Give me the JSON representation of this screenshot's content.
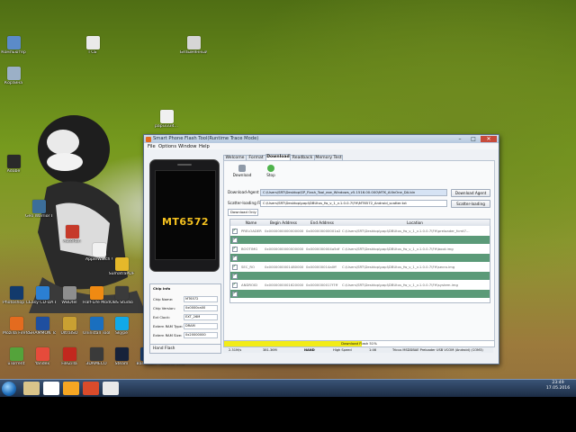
{
  "window": {
    "title": "Smart Phone Flash Tool(Runtime Trace Mode)",
    "controls": [
      "–",
      "□",
      "✕"
    ],
    "menus": [
      "File",
      "Options",
      "Window",
      "Help"
    ],
    "phone_chip": "MT6572",
    "tabs": [
      "Welcome",
      "Format",
      "Download",
      "Readback",
      "Memory Test"
    ],
    "active_tab": "Download",
    "toolbar": {
      "download_label": "Download",
      "stop_label": "Stop"
    },
    "download_agent": {
      "label": "Download-Agent",
      "value": "C:\\Users\\SRT\\Desktop\\SP_Flash_Tool_exe_Windows_v5.1516.00.000\\MTK_AllInOne_DA.bin",
      "button": "Download Agent"
    },
    "scatter": {
      "label": "Scatter-loading File",
      "value": "C:\\Users\\SRT\\Desktop\\papi\\DBUtus_fw_v_1_v.1.0.0.7\\FH\\MT6572_Android_scatter.txt",
      "button": "Scatter-loading"
    },
    "mode_select": "Download Only",
    "columns": [
      "",
      "Name",
      "Begin Address",
      "End Address",
      "Location"
    ],
    "rows": [
      {
        "checked": true,
        "name": "PRELOADER",
        "begin": "0x0000000000000000",
        "end": "0x000000000001a27",
        "location": "C:\\Users\\SRT\\Desktop\\papi\\DBUtus_fw_v_1_v.1.0.0.7\\FH\\preloader_fcmt7..."
      },
      {
        "checked": true,
        "name": "",
        "begin": "",
        "end": "",
        "location": ""
      },
      {
        "checked": true,
        "name": "BOOTIMG",
        "begin": "0x0000000000000000",
        "end": "0x0000000004a5df",
        "location": "C:\\Users\\SRT\\Desktop\\papi\\DBUtus_fw_v_1_v.1.0.0.7\\FH\\boot.img"
      },
      {
        "checked": true,
        "name": "",
        "begin": "",
        "end": "",
        "location": ""
      },
      {
        "checked": true,
        "name": "SEC_RO",
        "begin": "0x0000000001480000",
        "end": "0x000000014a0ff",
        "location": "C:\\Users\\SRT\\Desktop\\papi\\DBUtus_fw_v_1_v.1.0.0.7\\FH\\secro.img"
      },
      {
        "checked": true,
        "name": "",
        "begin": "",
        "end": "",
        "location": ""
      },
      {
        "checked": true,
        "name": "ANDROID",
        "begin": "0x0000000001620000",
        "end": "0x0000000017f7ff",
        "location": "C:\\Users\\SRT\\Desktop\\papi\\DBUtus_fw_v_1_v.1.0.0.7\\FH\\system.img"
      },
      {
        "checked": true,
        "name": "",
        "begin": "",
        "end": "",
        "location": ""
      }
    ],
    "chip_info": {
      "title": "Chip Info",
      "fields": [
        {
          "label": "Chip Name:",
          "value": "MT6572"
        },
        {
          "label": "Chip Version:",
          "value": "0x0000ca00"
        },
        {
          "label": "Ext Clock:",
          "value": "EXT_26M"
        },
        {
          "label": "Extern RAM Type:",
          "value": "DRAM"
        },
        {
          "label": "Extern RAM Size:",
          "value": "0x20000000"
        }
      ]
    },
    "hand_flash": "Hand Flash",
    "progress": {
      "text": "Download Flash 51%",
      "percent": 51
    },
    "status": [
      "2.31M/s",
      "381.36M",
      "NAND",
      "High Speed",
      "1:46",
      "Tricus MSDDBAE Preloader USB VCOM (Android) (COM3)"
    ]
  },
  "desktop_icons": [
    {
      "label": "Компьютер",
      "color": "#5b8bc9"
    },
    {
      "label": "ГСБ",
      "color": "#eaeaea"
    },
    {
      "label": "Безымянный",
      "color": "#d6d6d6"
    },
    {
      "label": "Корзина",
      "color": "#9bb0c7"
    },
    {
      "label": "papi3334...",
      "color": "#f0f0f0"
    },
    {
      "label": "Adobe",
      "color": "#2a2a2a"
    },
    {
      "label": "Geo Warrior Dominate...",
      "color": "#3c6e9a"
    },
    {
      "label": "AutoRun",
      "color": "#c63a2a"
    },
    {
      "label": "AppleWatch Wallpaper",
      "color": "#f2f2f2"
    },
    {
      "label": "SumatraPDF",
      "color": "#e5b82a"
    },
    {
      "label": "Photoshop CS6 x64",
      "color": "#123a6c"
    },
    {
      "label": "Easy CD-DA Extractor",
      "color": "#2b7fd3"
    },
    {
      "label": "WBDtel",
      "color": "#8e8e8e"
    },
    {
      "label": "Half-Life Model Viewer",
      "color": "#f08a12"
    },
    {
      "label": "OBS Studio",
      "color": "#3b3b3b"
    },
    {
      "label": "Mozilla Firefox",
      "color": "#e46b1f"
    },
    {
      "label": "SHAMMON Tools Lite",
      "color": "#1f4fa0"
    },
    {
      "label": "UltraISO",
      "color": "#c9a032"
    },
    {
      "label": "Uninstall Tool",
      "color": "#1a6fbf"
    },
    {
      "label": "Skype",
      "color": "#11a9e8"
    },
    {
      "label": "uTorrent",
      "color": "#54a33b"
    },
    {
      "label": "Yandex",
      "color": "#e64b3b"
    },
    {
      "label": "FileZilla",
      "color": "#c2281e"
    },
    {
      "label": "3DAMECO",
      "color": "#3a3a3a"
    },
    {
      "label": "Steam",
      "color": "#17223a"
    },
    {
      "label": "Bandicam",
      "color": "#1b3d6c"
    },
    {
      "label": "HideMe VPN",
      "color": "#2b5e93"
    }
  ],
  "clock": {
    "time": "23:49",
    "date": "17.05.2016"
  }
}
